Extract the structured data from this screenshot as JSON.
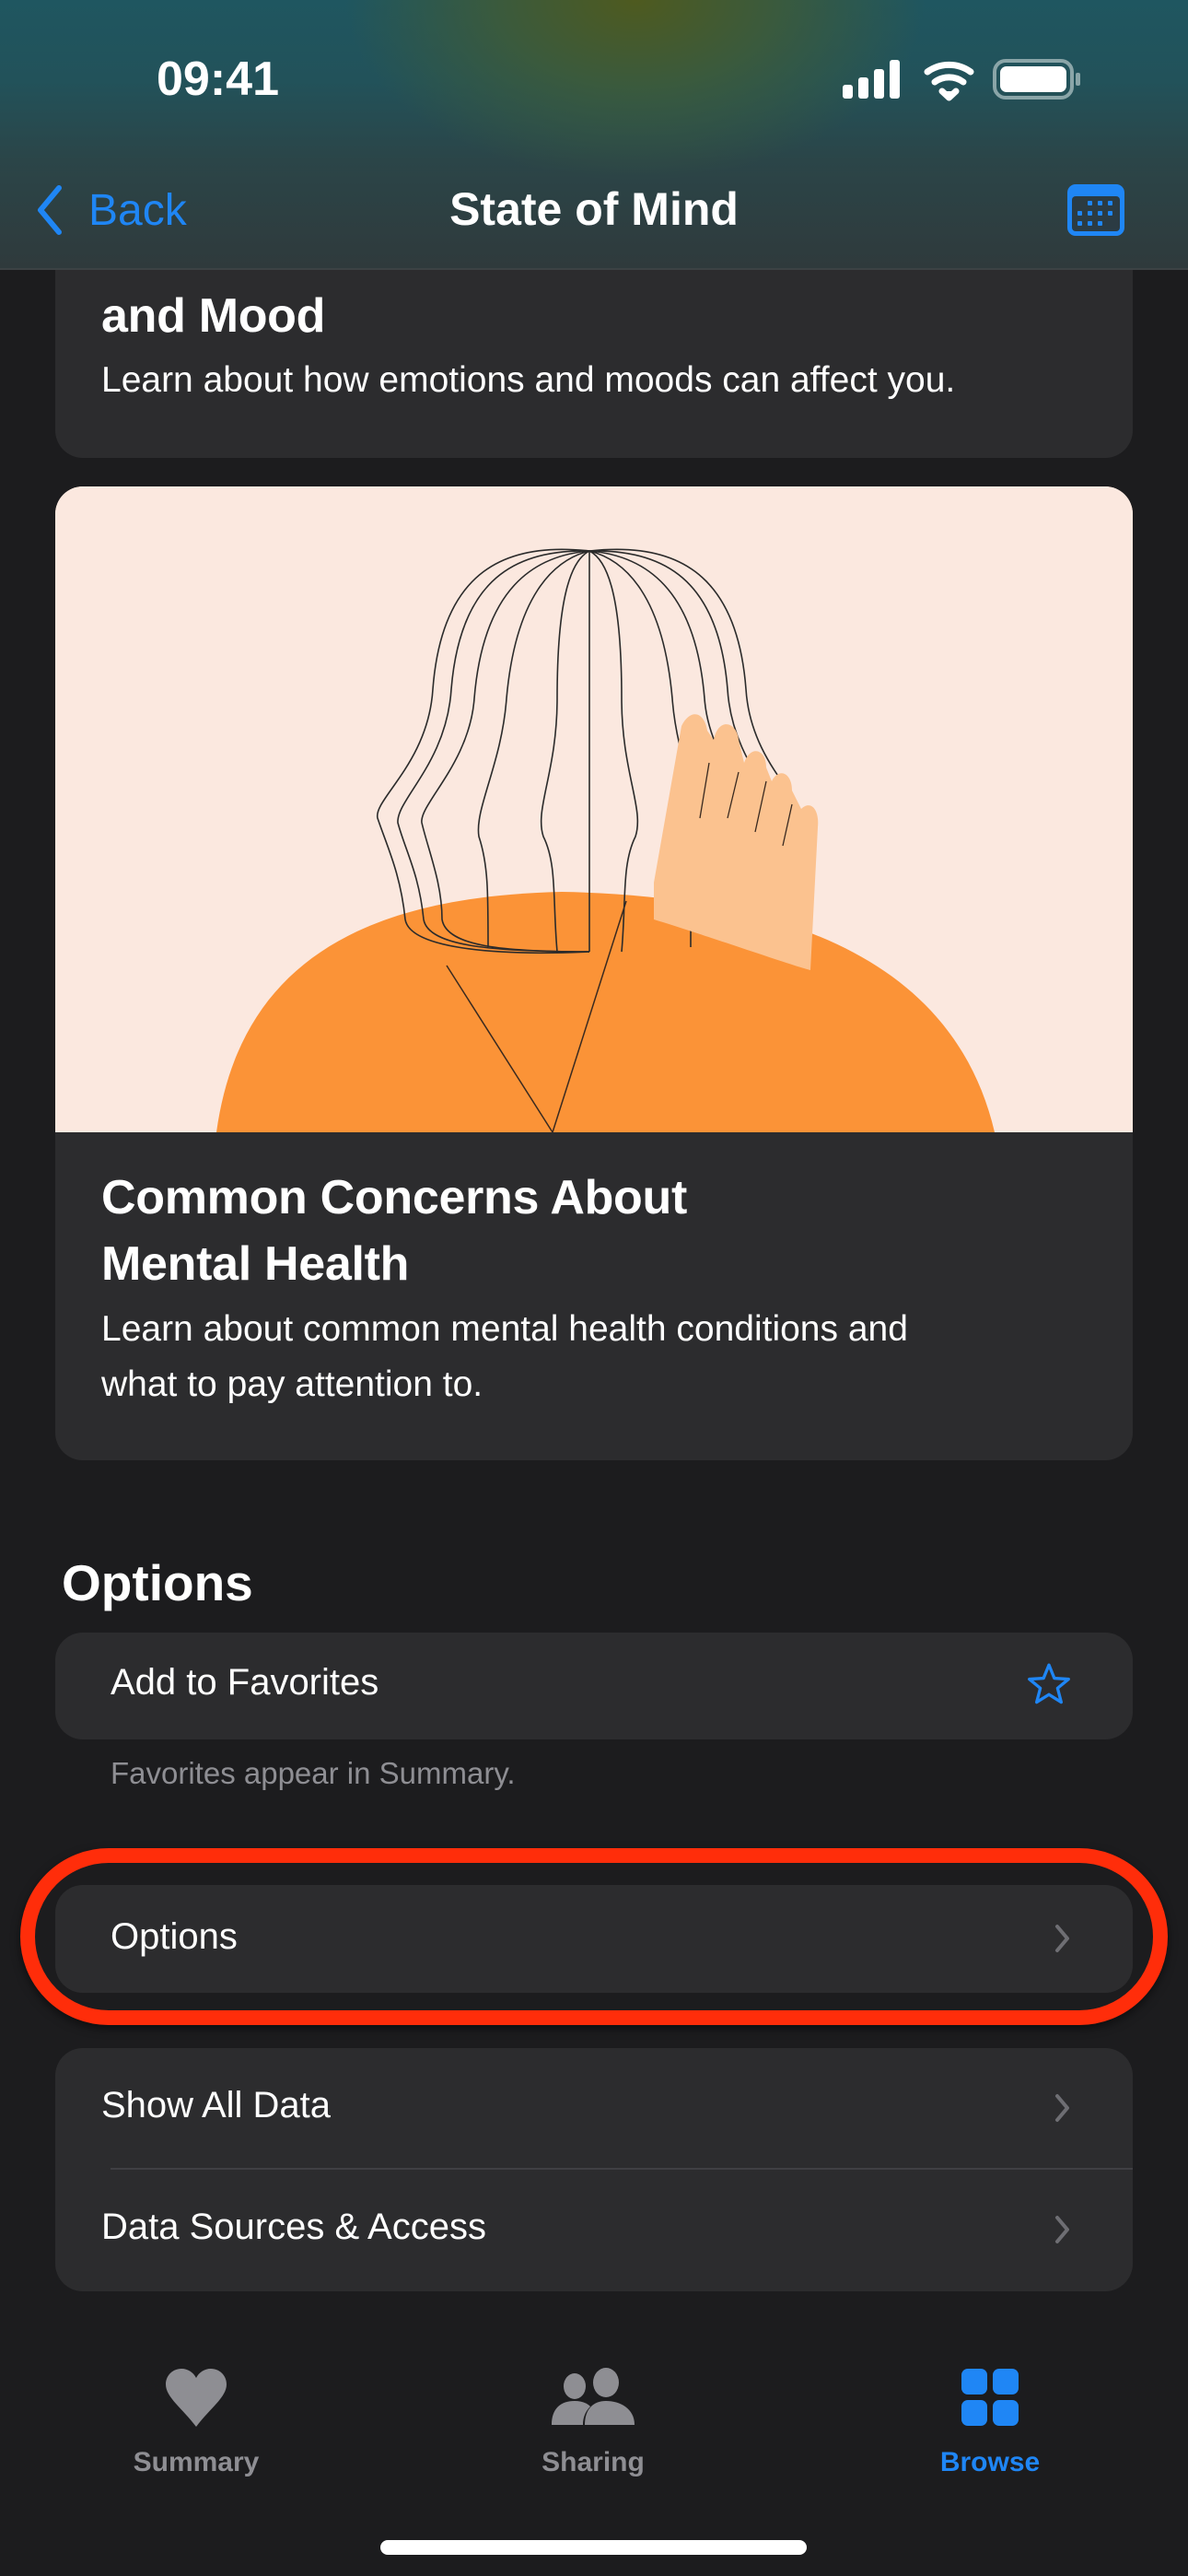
{
  "status_bar": {
    "time": "09:41",
    "icons": [
      "cellular-signal-icon",
      "wifi-icon",
      "battery-icon"
    ]
  },
  "nav": {
    "back_label": "Back",
    "title": "State of Mind",
    "right_icon": "calendar-icon",
    "accent_color": "#1F86F5"
  },
  "articles": [
    {
      "title": "and Mood",
      "description": "Learn about how emotions and moods can affect you."
    },
    {
      "title_line1": "Common Concerns About",
      "title_line2": "Mental Health",
      "description_line1": "Learn about common mental health conditions and",
      "description_line2": "what to pay attention to.",
      "image": "illustration-person-with-hand-on-shoulder"
    }
  ],
  "options_section": {
    "header": "Options",
    "favorites": {
      "label": "Add to Favorites",
      "icon": "star-outline-icon",
      "footnote": "Favorites appear in Summary."
    },
    "options_row": {
      "label": "Options",
      "highlighted": true,
      "highlight_color": "#FF2D0A"
    },
    "data_rows": [
      {
        "label": "Show All Data"
      },
      {
        "label": "Data Sources & Access"
      }
    ]
  },
  "tab_bar": {
    "tabs": [
      {
        "label": "Summary",
        "icon": "heart-icon",
        "active": false
      },
      {
        "label": "Sharing",
        "icon": "people-icon",
        "active": false
      },
      {
        "label": "Browse",
        "icon": "grid-icon",
        "active": true
      }
    ]
  }
}
